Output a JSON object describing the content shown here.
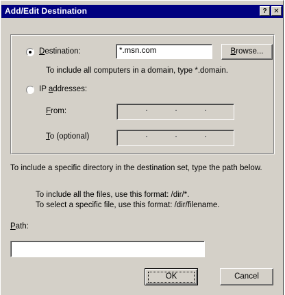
{
  "window": {
    "title": "Add/Edit Destination",
    "help_button": "?",
    "close_button": "✕"
  },
  "destination_group": {
    "destination_option": {
      "label_accel": "D",
      "label_rest": "estination:",
      "selected": true
    },
    "destination_value": "*.msn.com",
    "browse_button": {
      "label_accel": "B",
      "label_rest": "rowse..."
    },
    "domain_hint": "To include all computers in a domain, type *.domain.",
    "ip_option": {
      "label_pre": "IP ",
      "label_accel": "a",
      "label_rest": "ddresses:",
      "selected": false
    },
    "from_label": {
      "label_accel": "F",
      "label_rest": "rom:"
    },
    "to_label": {
      "label_accel": "T",
      "label_rest": "o (optional)"
    }
  },
  "path_section": {
    "instruction": "To include a specific directory in the destination set, type the path below.",
    "hint_all_files": "To include all the files, use this format: /dir/*.",
    "hint_specific_file": "To select a specific file, use this format: /dir/filename.",
    "path_label": {
      "label_accel": "P",
      "label_rest": "ath:"
    },
    "path_value": ""
  },
  "buttons": {
    "ok": "OK",
    "cancel": "Cancel"
  }
}
